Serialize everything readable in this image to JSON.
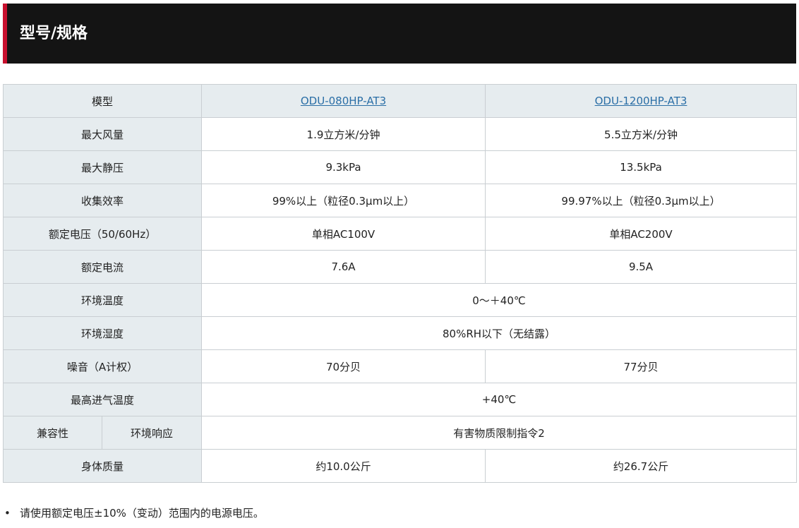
{
  "header": {
    "title": "型号/规格"
  },
  "table": {
    "header_label": "模型",
    "models": [
      "ODU-080HP-AT3",
      "ODU-1200HP-AT3"
    ],
    "rows": {
      "airflow": {
        "label": "最大风量",
        "values": [
          "1.9立方米/分钟",
          "5.5立方米/分钟"
        ]
      },
      "static_pressure": {
        "label": "最大静压",
        "values": [
          "9.3kPa",
          "13.5kPa"
        ]
      },
      "efficiency": {
        "label": "收集效率",
        "values": [
          "99%以上（粒径0.3μm以上）",
          "99.97%以上（粒径0.3μm以上）"
        ]
      },
      "voltage": {
        "label": "额定电压（50/60Hz）",
        "values": [
          "单相AC100V",
          "单相AC200V"
        ]
      },
      "current": {
        "label": "额定电流",
        "values": [
          "7.6A",
          "9.5A"
        ]
      },
      "ambient_temp": {
        "label": "环境温度",
        "value": "0～＋40℃"
      },
      "ambient_humidity": {
        "label": "环境湿度",
        "value": "80%RH以下（无结露）"
      },
      "noise": {
        "label": "噪音（A计权）",
        "values": [
          "70分贝",
          "77分贝"
        ]
      },
      "max_intake_temp": {
        "label": "最高进气温度",
        "value": "+40℃"
      },
      "compatibility": {
        "label": "兼容性",
        "sublabel": "环境响应",
        "value": "有害物质限制指令2"
      },
      "weight": {
        "label": "身体质量",
        "values": [
          "约10.0公斤",
          "约26.7公斤"
        ]
      }
    }
  },
  "note": {
    "bullet": "•",
    "text": "请使用额定电压±10%（变动）范围内的电源电压。"
  },
  "colors": {
    "header_bg": "#141414",
    "accent": "#c8102e",
    "label_bg": "#e6ecef",
    "link": "#2a6ea6",
    "border": "#c9ced2"
  }
}
